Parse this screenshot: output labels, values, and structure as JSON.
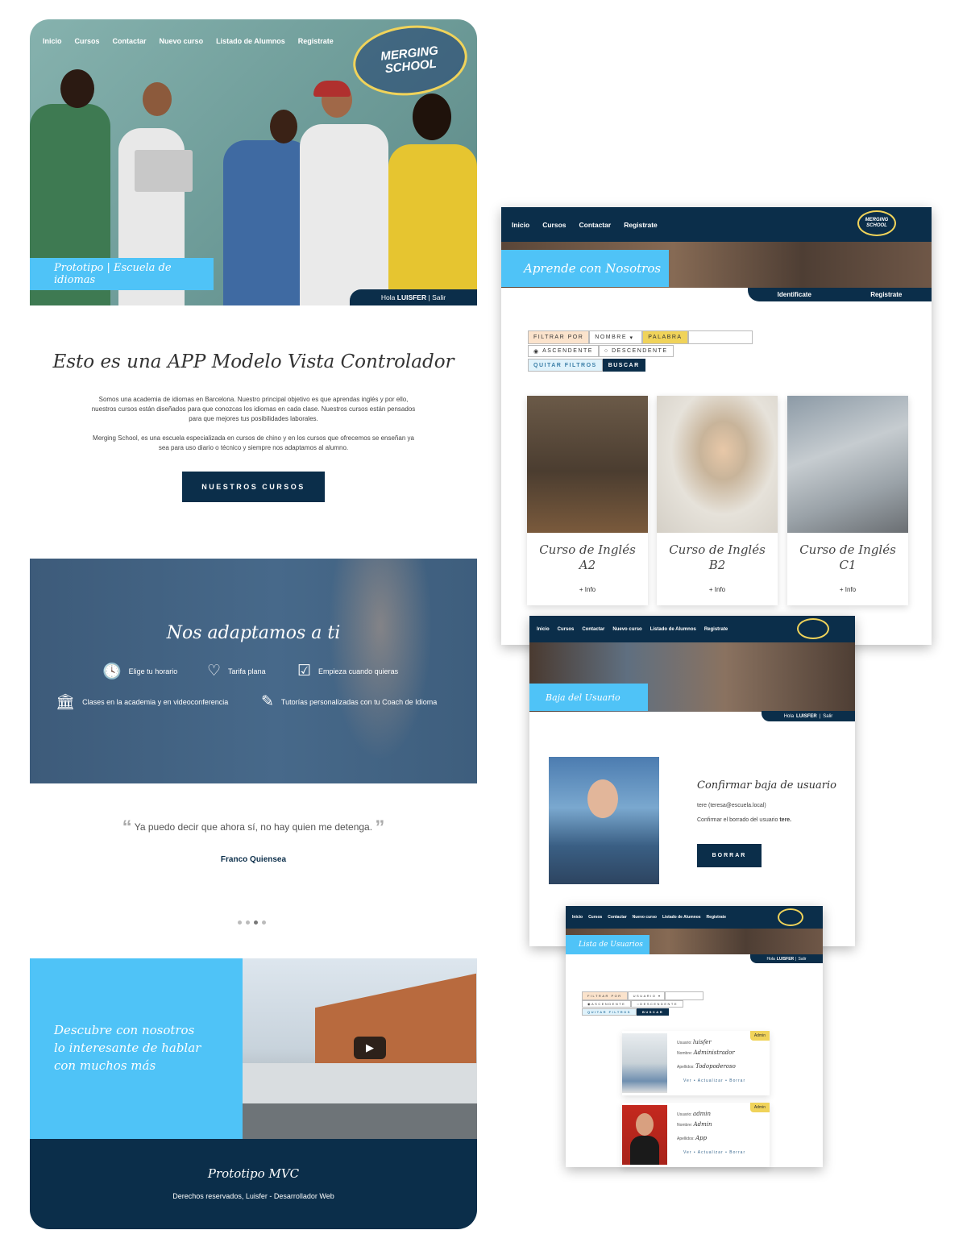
{
  "home": {
    "nav": [
      "Inicio",
      "Cursos",
      "Contactar",
      "Nuevo curso",
      "Listado de Alumnos",
      "Registrate"
    ],
    "logo_top": "MERGING",
    "logo_bottom": "SCHOOL",
    "caption": "Prototipo | Escuela de idiomas",
    "hola": "Hola",
    "user": "LUISFER",
    "sep": "|",
    "salir": "Salir",
    "intro_title": "Esto es una APP Modelo Vista Controlador",
    "intro_p1": "Somos una academia de idiomas en Barcelona. Nuestro principal objetivo es que aprendas inglés y por ello, nuestros cursos están diseñados para que conozcas los idiomas en cada clase. Nuestros cursos están pensados para que mejores tus posibilidades laborales.",
    "intro_p2": "Merging School, es una escuela especializada en cursos de chino y en los cursos que ofrecemos se enseñan ya sea para uso diario o técnico y siempre nos adaptamos al alumno.",
    "btn_cursos": "NUESTROS CURSOS",
    "adapt_title": "Nos adaptamos a ti",
    "features": [
      {
        "icon": "clock-icon",
        "label": "Elige tu horario"
      },
      {
        "icon": "heart-icon",
        "label": "Tarifa plana"
      },
      {
        "icon": "calendar-check-icon",
        "label": "Empieza cuando quieras"
      },
      {
        "icon": "institution-icon",
        "label": "Clases en la academia y en videoconferencia"
      },
      {
        "icon": "edit-icon",
        "label": "Tutorías personalizadas con tu Coach de Idioma"
      }
    ],
    "quote": "Ya puedo decir que ahora sí, no hay quien me detenga.",
    "quote_author": "Franco Quiensea",
    "descubre": [
      "Descubre con nosotros",
      "lo interesante de hablar",
      "con muchos más"
    ],
    "footer_title": "Prototipo MVC",
    "footer_text": "Derechos reservados, Luisfer - Desarrollador Web"
  },
  "courses": {
    "nav": [
      "Inicio",
      "Cursos",
      "Contactar",
      "Registrate"
    ],
    "logo_top": "MERGING",
    "logo_bottom": "SCHOOL",
    "banner": "Aprende con Nosotros",
    "identificate": "Identificate",
    "registrate": "Registrate",
    "filter_label": "FILTRAR POR",
    "filter_select": "NOMBRE",
    "palabra": "PALABRA",
    "asc": "ASCENDENTE",
    "desc": "DESCENDENTE",
    "quitar": "QUITAR FILTROS",
    "buscar": "BUSCAR",
    "cards": [
      {
        "line1": "Curso de Inglés",
        "line2": "A2",
        "more": "+ Info"
      },
      {
        "line1": "Curso de Inglés",
        "line2": "B2",
        "more": "+ Info"
      },
      {
        "line1": "Curso de Inglés",
        "line2": "C1",
        "more": "+ Info"
      }
    ]
  },
  "baja": {
    "nav": [
      "Inicio",
      "Cursos",
      "Contactar",
      "Nuevo curso",
      "Listado de Alumnos",
      "Registrate"
    ],
    "banner": "Baja del Usuario",
    "hola": "Hola",
    "user": "LUISFER",
    "salir": "Salir",
    "confirm_title": "Confirmar baja de usuario",
    "user_line": "tere (teresa@escuela.local)",
    "confirm_text": "Confirmar el borrado del usuario",
    "confirm_user": "tere.",
    "borrar": "BORRAR"
  },
  "lista": {
    "nav": [
      "Inicio",
      "Cursos",
      "Contactar",
      "Nuevo curso",
      "Listado de Alumnos",
      "Registrate"
    ],
    "banner": "Lista de Usuarios",
    "hola": "Hola",
    "user": "LUISFER",
    "salir": "Salir",
    "filter_label": "FILTRAR POR",
    "filter_select": "USUARIO",
    "asc": "ASCENDENTE",
    "desc": "DESCENDENTE",
    "quitar": "QUITAR FILTROS",
    "buscar": "BUSCAR",
    "users": [
      {
        "badge": "Admin",
        "usuario_l": "Usuario:",
        "usuario": "luisfer",
        "nombre_l": "Nombre:",
        "nombre": "Administrador",
        "apellidos_l": "Apellidos:",
        "apellidos": "Todopoderoso",
        "actions": "Ver • Actualizar • Borrar"
      },
      {
        "badge": "Admin",
        "usuario_l": "Usuario:",
        "usuario": "admin",
        "nombre_l": "Nombre:",
        "nombre": "Admin",
        "apellidos_l": "Apellidos:",
        "apellidos": "App",
        "actions": "Ver • Actualizar • Borrar"
      }
    ]
  }
}
